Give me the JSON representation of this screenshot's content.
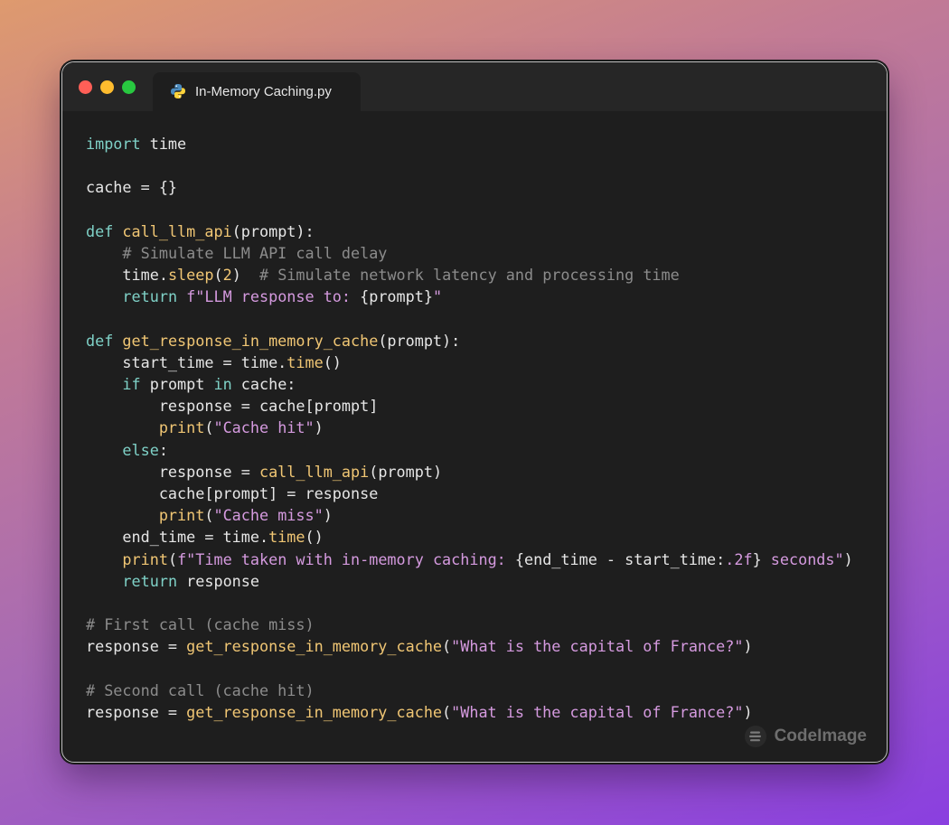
{
  "window": {
    "controls": [
      "close",
      "minimize",
      "maximize"
    ],
    "tab": {
      "label": "In-Memory Caching.py",
      "icon": "python-icon"
    }
  },
  "theme": {
    "keyword": "#7fd1c7",
    "function": "#f0c674",
    "string": "#d59adf",
    "comment": "#8c8c8c",
    "text": "#e6e6e6",
    "editor_bg": "#1e1e1e"
  },
  "code": {
    "language": "python",
    "lines": [
      [
        [
          "keyword",
          "import"
        ],
        [
          "plain",
          " time"
        ]
      ],
      [],
      [
        [
          "plain",
          "cache = {}"
        ]
      ],
      [],
      [
        [
          "keyword",
          "def"
        ],
        [
          "plain",
          " "
        ],
        [
          "func",
          "call_llm_api"
        ],
        [
          "plain",
          "(prompt):"
        ]
      ],
      [
        [
          "plain",
          "    "
        ],
        [
          "comment",
          "# Simulate LLM API call delay"
        ]
      ],
      [
        [
          "plain",
          "    time."
        ],
        [
          "func",
          "sleep"
        ],
        [
          "plain",
          "("
        ],
        [
          "number",
          "2"
        ],
        [
          "plain",
          ")  "
        ],
        [
          "comment",
          "# Simulate network latency and processing time"
        ]
      ],
      [
        [
          "plain",
          "    "
        ],
        [
          "keyword",
          "return"
        ],
        [
          "plain",
          " "
        ],
        [
          "string",
          "f\"LLM response to: "
        ],
        [
          "plain",
          "{prompt}"
        ],
        [
          "string",
          "\""
        ]
      ],
      [],
      [
        [
          "keyword",
          "def"
        ],
        [
          "plain",
          " "
        ],
        [
          "func",
          "get_response_in_memory_cache"
        ],
        [
          "plain",
          "(prompt):"
        ]
      ],
      [
        [
          "plain",
          "    start_time = time."
        ],
        [
          "func",
          "time"
        ],
        [
          "plain",
          "()"
        ]
      ],
      [
        [
          "plain",
          "    "
        ],
        [
          "keyword",
          "if"
        ],
        [
          "plain",
          " prompt "
        ],
        [
          "keyword",
          "in"
        ],
        [
          "plain",
          " cache:"
        ]
      ],
      [
        [
          "plain",
          "        response = cache[prompt]"
        ]
      ],
      [
        [
          "plain",
          "        "
        ],
        [
          "func",
          "print"
        ],
        [
          "plain",
          "("
        ],
        [
          "string",
          "\"Cache hit\""
        ],
        [
          "plain",
          ")"
        ]
      ],
      [
        [
          "plain",
          "    "
        ],
        [
          "keyword",
          "else"
        ],
        [
          "plain",
          ":"
        ]
      ],
      [
        [
          "plain",
          "        response = "
        ],
        [
          "func",
          "call_llm_api"
        ],
        [
          "plain",
          "(prompt)"
        ]
      ],
      [
        [
          "plain",
          "        cache[prompt] = response"
        ]
      ],
      [
        [
          "plain",
          "        "
        ],
        [
          "func",
          "print"
        ],
        [
          "plain",
          "("
        ],
        [
          "string",
          "\"Cache miss\""
        ],
        [
          "plain",
          ")"
        ]
      ],
      [
        [
          "plain",
          "    end_time = time."
        ],
        [
          "func",
          "time"
        ],
        [
          "plain",
          "()"
        ]
      ],
      [
        [
          "plain",
          "    "
        ],
        [
          "func",
          "print"
        ],
        [
          "plain",
          "("
        ],
        [
          "string",
          "f\"Time taken with in-memory caching: "
        ],
        [
          "plain",
          "{end_time - start_time:"
        ],
        [
          "string",
          ".2f"
        ],
        [
          "plain",
          "}"
        ],
        [
          "string",
          " seconds\""
        ],
        [
          "plain",
          ")"
        ]
      ],
      [
        [
          "plain",
          "    "
        ],
        [
          "keyword",
          "return"
        ],
        [
          "plain",
          " response"
        ]
      ],
      [],
      [
        [
          "comment",
          "# First call (cache miss)"
        ]
      ],
      [
        [
          "plain",
          "response = "
        ],
        [
          "func",
          "get_response_in_memory_cache"
        ],
        [
          "plain",
          "("
        ],
        [
          "string",
          "\"What is the capital of France?\""
        ],
        [
          "plain",
          ")"
        ]
      ],
      [],
      [
        [
          "comment",
          "# Second call (cache hit)"
        ]
      ],
      [
        [
          "plain",
          "response = "
        ],
        [
          "func",
          "get_response_in_memory_cache"
        ],
        [
          "plain",
          "("
        ],
        [
          "string",
          "\"What is the capital of France?\""
        ],
        [
          "plain",
          ")"
        ]
      ]
    ]
  },
  "watermark": {
    "text": "CodeImage",
    "icon": "codeimage-logo-icon"
  }
}
